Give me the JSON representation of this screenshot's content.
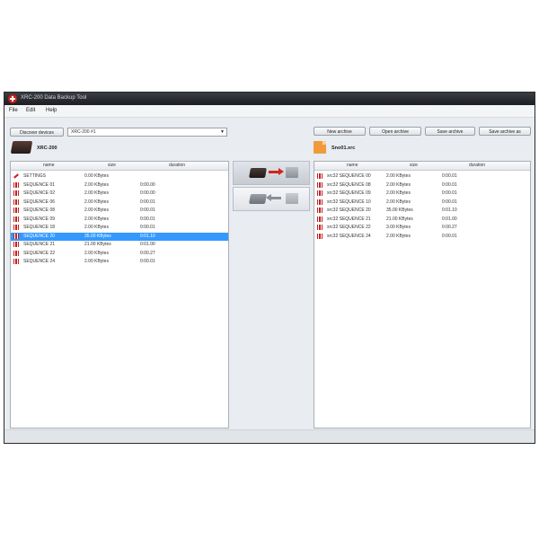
{
  "window": {
    "title": "XRC-200 Data Backup Tool"
  },
  "menu": [
    "File",
    "Edit",
    "Help"
  ],
  "toolbar": {
    "discover_label": "Discover devices",
    "device_select_value": "XRC-200 #1",
    "new_archive_label": "New archive",
    "open_archive_label": "Open archive",
    "save_archive_label": "Save archive",
    "save_archive_as_label": "Save archive as"
  },
  "left_panel": {
    "device_name": "XRC-200",
    "columns": [
      "name",
      "size",
      "duration"
    ],
    "rows": [
      {
        "name": "SETTINGS",
        "size": "0.00 KBytes",
        "duration": "",
        "icon": "wrench-icon",
        "selected": false
      },
      {
        "name": "SEQUENCE 01",
        "size": "2.00 KBytes",
        "duration": "0:00.00",
        "icon": "sequence-icon",
        "selected": false
      },
      {
        "name": "SEQUENCE 02",
        "size": "2.00 KBytes",
        "duration": "0:00.00",
        "icon": "sequence-icon",
        "selected": false
      },
      {
        "name": "SEQUENCE 06",
        "size": "2.00 KBytes",
        "duration": "0:00.01",
        "icon": "sequence-icon",
        "selected": false
      },
      {
        "name": "SEQUENCE 08",
        "size": "2.00 KBytes",
        "duration": "0:00.01",
        "icon": "sequence-icon",
        "selected": false
      },
      {
        "name": "SEQUENCE 09",
        "size": "2.00 KBytes",
        "duration": "0:00.01",
        "icon": "sequence-icon",
        "selected": false
      },
      {
        "name": "SEQUENCE 18",
        "size": "2.00 KBytes",
        "duration": "0:00.01",
        "icon": "sequence-icon",
        "selected": false
      },
      {
        "name": "SEQUENCE 20",
        "size": "35.00 KBytes",
        "duration": "0:01.10",
        "icon": "sequence-icon",
        "selected": true
      },
      {
        "name": "SEQUENCE 21",
        "size": "21.00 KBytes",
        "duration": "0:01.00",
        "icon": "sequence-icon",
        "selected": false
      },
      {
        "name": "SEQUENCE 22",
        "size": "2.00 KBytes",
        "duration": "0:00.27",
        "icon": "sequence-icon",
        "selected": false
      },
      {
        "name": "SEQUENCE 24",
        "size": "2.00 KBytes",
        "duration": "0:00.01",
        "icon": "sequence-icon",
        "selected": false
      }
    ]
  },
  "right_panel": {
    "file_name": "Sno01.xrc",
    "columns": [
      "name",
      "size",
      "duration"
    ],
    "rows": [
      {
        "name": "xrc32 SEQUENCE 00",
        "size": "2.00 KBytes",
        "duration": "0:00.01"
      },
      {
        "name": "xrc32 SEQUENCE 08",
        "size": "2.00 KBytes",
        "duration": "0:00.01"
      },
      {
        "name": "xrc32 SEQUENCE 09",
        "size": "2.00 KBytes",
        "duration": "0:00.01"
      },
      {
        "name": "xrc32 SEQUENCE 10",
        "size": "2.00 KBytes",
        "duration": "0:00.01"
      },
      {
        "name": "xrc32 SEQUENCE 20",
        "size": "35.00 KBytes",
        "duration": "0:01.10"
      },
      {
        "name": "xrc32 SEQUENCE 21",
        "size": "21.00 KBytes",
        "duration": "0:01.00"
      },
      {
        "name": "xrc32 SEQUENCE 22",
        "size": "3.00 KBytes",
        "duration": "0:00.27"
      },
      {
        "name": "xrc32 SEQUENCE 24",
        "size": "2.00 KBytes",
        "duration": "0:00.01"
      }
    ]
  },
  "transfer": {
    "device_to_archive": "arrow-right-icon",
    "archive_to_device": "arrow-left-icon"
  },
  "colors": {
    "selection": "#3399ff",
    "accent": "#c62020",
    "archive_icon": "#f09a3c"
  }
}
